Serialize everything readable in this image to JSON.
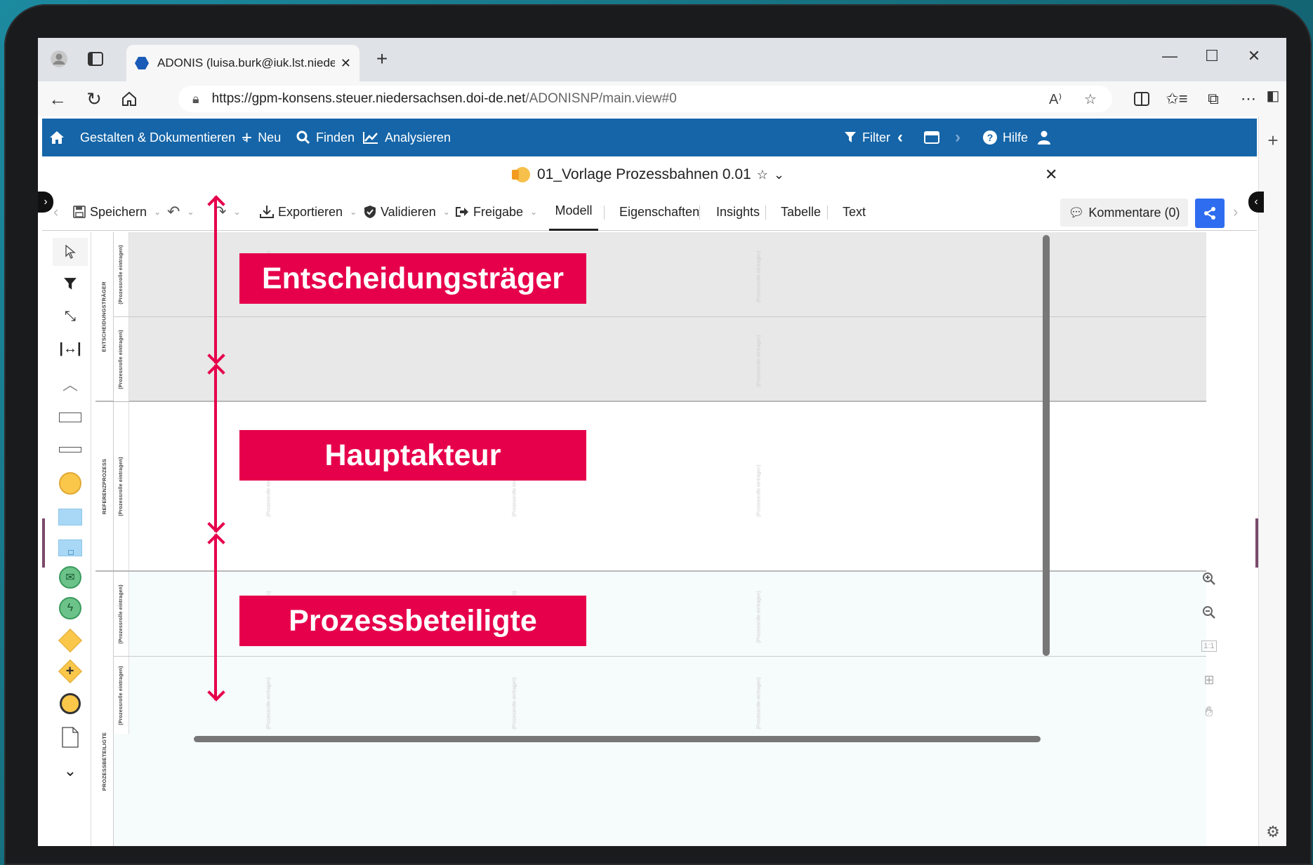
{
  "browser": {
    "tab_title": "ADONIS (luisa.burk@iuk.lst.niede",
    "url_host": "https://gpm-konsens.steuer.niedersachsen.doi-de.net",
    "url_path": "/ADONISNP/main.view#0"
  },
  "nav": {
    "menu1": "Gestalten & Dokumentieren",
    "neu": "Neu",
    "finden": "Finden",
    "analysieren": "Analysieren",
    "filter": "Filter",
    "hilfe": "Hilfe"
  },
  "document": {
    "title": "01_Vorlage Prozessbahnen 0.01"
  },
  "toolbar": {
    "speichern": "Speichern",
    "exportieren": "Exportieren",
    "validieren": "Validieren",
    "freigabe": "Freigabe",
    "tabs": [
      "Modell",
      "Eigenschaften",
      "Insights",
      "Tabelle",
      "Text"
    ],
    "kommentare": "Kommentare (0)"
  },
  "pools": {
    "p1": "ENTSCHEIDUNGSTRÄGER",
    "p2": "REFERENZPROZESS",
    "p3": "PROZESSBETEILIGTE",
    "lane": "(Prozessrolle eintragen)"
  },
  "zoom": {
    "one_to_one": "1:1"
  },
  "annotations": [
    "Entscheidungsträger",
    "Hauptakteur",
    "Prozessbeteiligte"
  ],
  "colors": {
    "nav_blue": "#1565a8",
    "annotation_red": "#e6004c",
    "share_blue": "#2f6df0"
  }
}
